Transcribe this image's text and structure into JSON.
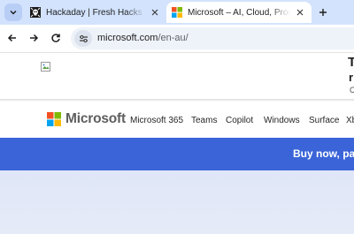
{
  "browser": {
    "tabs": [
      {
        "title": "Hackaday | Fresh Hacks Every Day",
        "favicon": "hackaday-skull-icon",
        "active": false
      },
      {
        "title": "Microsoft – AI, Cloud, Productivity",
        "favicon": "microsoft-logo-icon",
        "active": true
      }
    ],
    "address": {
      "host": "microsoft.com",
      "path": "/en-au/"
    }
  },
  "page": {
    "banner": {
      "line1": "T",
      "line2": "r",
      "line3": "C"
    },
    "header": {
      "brand": "Microsoft",
      "nav": [
        "Microsoft 365",
        "Teams",
        "Copilot",
        "Windows",
        "Surface",
        "Xb"
      ]
    },
    "promo": {
      "text": "Buy now, pay"
    },
    "colors": {
      "tabstrip": "#d3e3fd",
      "promo_bar": "#3a64d8",
      "ms_red": "#f25022",
      "ms_green": "#7fba00",
      "ms_blue": "#00a4ef",
      "ms_yellow": "#ffb900"
    }
  }
}
